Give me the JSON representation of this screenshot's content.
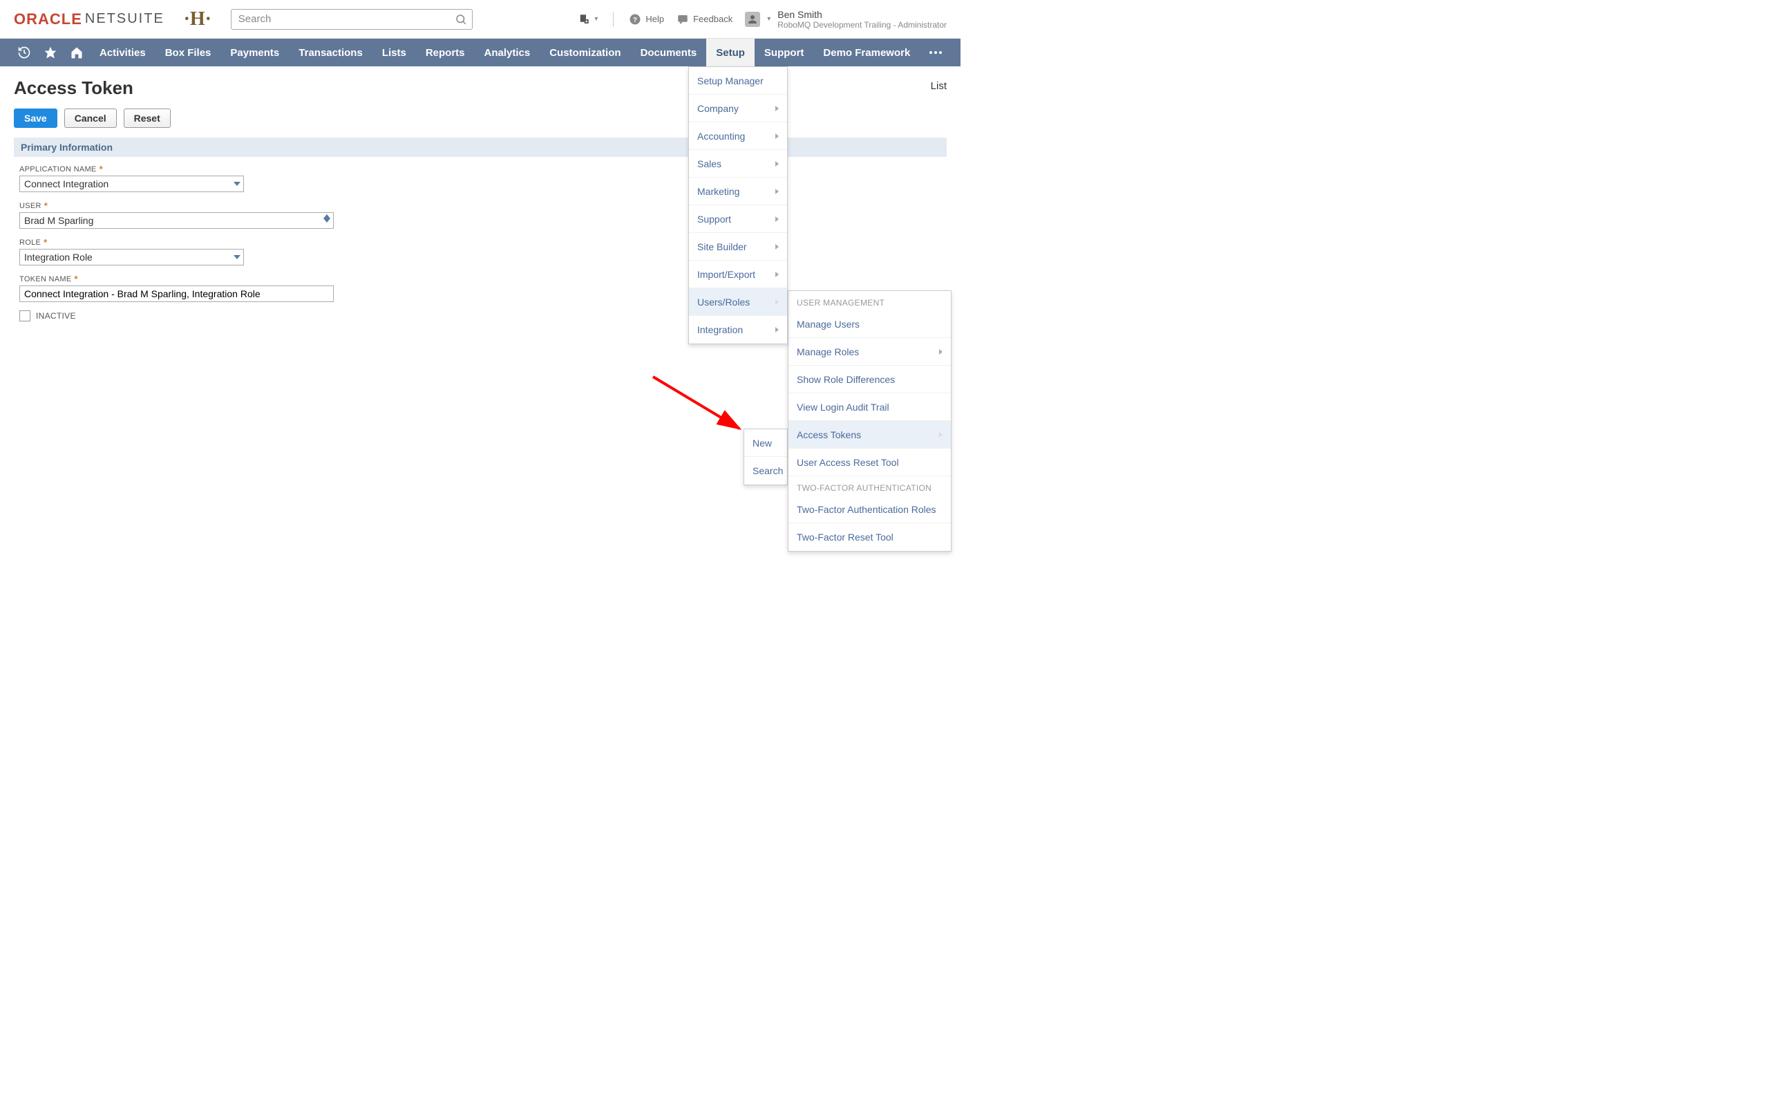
{
  "header": {
    "logo_oracle": "ORACLE",
    "logo_netsuite": "NETSUITE",
    "search_placeholder": "Search",
    "help": "Help",
    "feedback": "Feedback",
    "user_name": "Ben Smith",
    "user_role": "RoboMQ Development Trailing - Administrator"
  },
  "nav": {
    "items": [
      "Activities",
      "Box Files",
      "Payments",
      "Transactions",
      "Lists",
      "Reports",
      "Analytics",
      "Customization",
      "Documents",
      "Setup",
      "Support",
      "Demo Framework"
    ],
    "active": "Setup"
  },
  "page": {
    "title": "Access Token",
    "list_link": "List",
    "buttons": {
      "save": "Save",
      "cancel": "Cancel",
      "reset": "Reset"
    },
    "section": "Primary Information",
    "fields": {
      "app_name_label": "APPLICATION NAME",
      "app_name_value": "Connect Integration",
      "user_label": "USER",
      "user_value": "Brad M Sparling",
      "role_label": "ROLE",
      "role_value": "Integration Role",
      "token_label": "TOKEN NAME",
      "token_value": "Connect Integration - Brad M Sparling, Integration Role",
      "inactive_label": "INACTIVE"
    }
  },
  "setup_menu": {
    "items": [
      {
        "label": "Setup Manager",
        "arrow": false
      },
      {
        "label": "Company",
        "arrow": true
      },
      {
        "label": "Accounting",
        "arrow": true
      },
      {
        "label": "Sales",
        "arrow": true
      },
      {
        "label": "Marketing",
        "arrow": true
      },
      {
        "label": "Support",
        "arrow": true
      },
      {
        "label": "Site Builder",
        "arrow": true
      },
      {
        "label": "Import/Export",
        "arrow": true
      },
      {
        "label": "Users/Roles",
        "arrow": true,
        "highlight": true
      },
      {
        "label": "Integration",
        "arrow": true
      }
    ]
  },
  "users_roles_menu": {
    "section1_label": "USER MANAGEMENT",
    "section1": [
      {
        "label": "Manage Users"
      },
      {
        "label": "Manage Roles",
        "arrow": true
      },
      {
        "label": "Show Role Differences"
      },
      {
        "label": "View Login Audit Trail"
      },
      {
        "label": "Access Tokens",
        "arrow": true,
        "highlight": true
      },
      {
        "label": "User Access Reset Tool"
      }
    ],
    "section2_label": "TWO-FACTOR AUTHENTICATION",
    "section2": [
      {
        "label": "Two-Factor Authentication Roles"
      },
      {
        "label": "Two-Factor Reset Tool"
      }
    ]
  },
  "access_tokens_menu": {
    "items": [
      "New",
      "Search"
    ]
  }
}
